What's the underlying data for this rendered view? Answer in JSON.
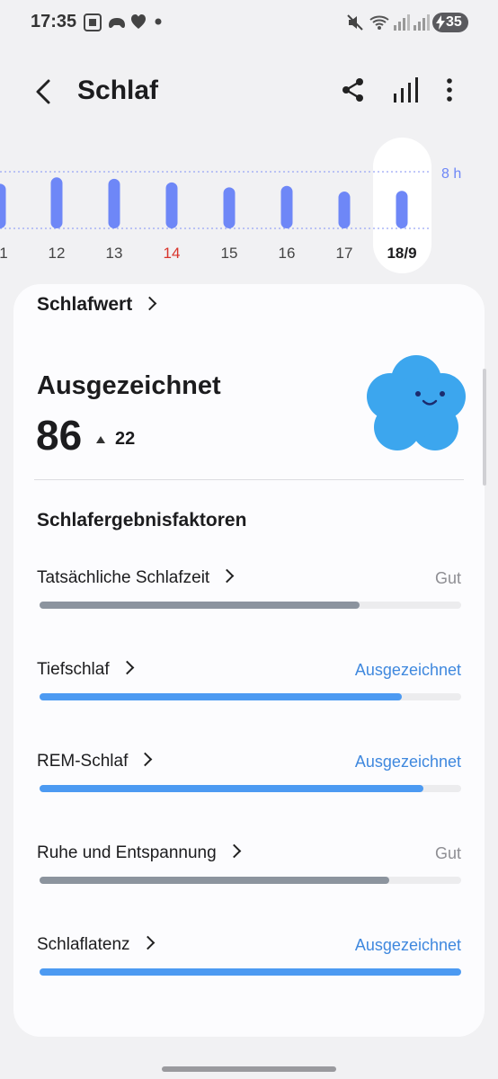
{
  "status": {
    "time": "17:35",
    "battery": "35"
  },
  "header": {
    "title": "Schlaf",
    "back_icon": "back-arrow-icon",
    "share_icon": "share-icon",
    "stats_icon": "bar-chart-icon",
    "more_icon": "more-vertical-icon"
  },
  "chart": {
    "ref_label": "8 h",
    "days": [
      {
        "label": "1",
        "color": "#444444"
      },
      {
        "label": "12",
        "color": "#444444"
      },
      {
        "label": "13",
        "color": "#444444"
      },
      {
        "label": "14",
        "color": "#d9342b"
      },
      {
        "label": "15",
        "color": "#444444"
      },
      {
        "label": "16",
        "color": "#444444"
      },
      {
        "label": "17",
        "color": "#444444"
      },
      {
        "label": "18/9",
        "color": "#1c1c1e"
      }
    ],
    "bar_color": "#6e87f7"
  },
  "chart_data": {
    "type": "bar",
    "categories": [
      "1",
      "12",
      "13",
      "14",
      "15",
      "16",
      "17",
      "18/9"
    ],
    "values": [
      6.3,
      7.2,
      7.0,
      6.5,
      5.8,
      6.0,
      5.2,
      5.3
    ],
    "reference_line": {
      "label": "8 h",
      "value": 8
    },
    "xlabel": "",
    "ylabel": ""
  },
  "score": {
    "heading": "Schlafwert",
    "rating": "Ausgezeichnet",
    "value": "86",
    "change": "22",
    "change_icon": "triangle-up-icon",
    "mascot": "cloud-mascot-icon"
  },
  "factors": {
    "heading": "Schlafergebnisfaktoren",
    "items": [
      {
        "label": "Tatsächliche Schlafzeit",
        "status": "Gut",
        "status_color": "#8e8e93",
        "bar_color": "#8c949e",
        "level": 0.76
      },
      {
        "label": "Tiefschlaf",
        "status": "Ausgezeichnet",
        "status_color": "#3f88de",
        "bar_color": "#4c9af2",
        "level": 0.86
      },
      {
        "label": "REM-Schlaf",
        "status": "Ausgezeichnet",
        "status_color": "#3f88de",
        "bar_color": "#4c9af2",
        "level": 0.91
      },
      {
        "label": "Ruhe und Entspannung",
        "status": "Gut",
        "status_color": "#8e8e93",
        "bar_color": "#8c949e",
        "level": 0.83
      },
      {
        "label": "Schlaflatenz",
        "status": "Ausgezeichnet",
        "status_color": "#3f88de",
        "bar_color": "#4c9af2",
        "level": 1.0
      }
    ]
  }
}
